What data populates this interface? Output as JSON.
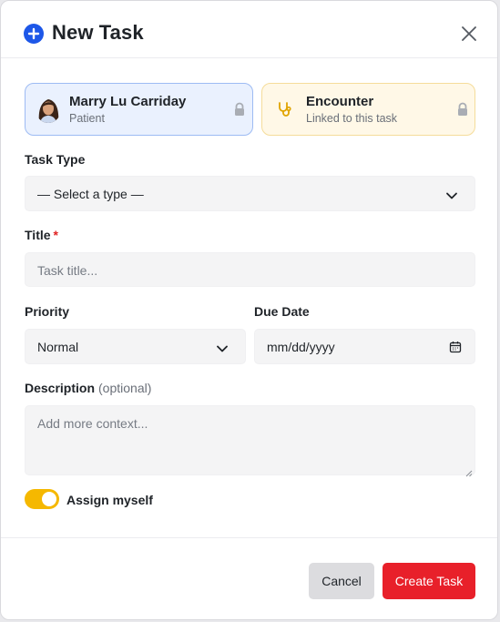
{
  "header": {
    "title": "New Task",
    "accent_color": "#1d57e8",
    "icons": {
      "leading": "plus-circle-icon",
      "close": "close-icon"
    }
  },
  "context": {
    "patient": {
      "name": "Marry Lu Carriday",
      "role": "Patient",
      "icon": "avatar",
      "locked": true
    },
    "encounter": {
      "title": "Encounter",
      "subtitle": "Linked to this task",
      "icon": "stethoscope-icon",
      "locked": true
    }
  },
  "form": {
    "task_type": {
      "label": "Task Type",
      "value": "— Select a type —"
    },
    "title": {
      "label": "Title",
      "required_mark": "*",
      "placeholder": "Task title..."
    },
    "priority": {
      "label": "Priority",
      "value": "Normal"
    },
    "due_date": {
      "label": "Due Date",
      "placeholder": "mm/dd/yyyy"
    },
    "description": {
      "label": "Description",
      "optional_note": "(optional)",
      "placeholder": "Add more context..."
    },
    "assign_myself": {
      "label": "Assign myself",
      "checked": true,
      "color": "#f5b800"
    }
  },
  "footer": {
    "cancel_label": "Cancel",
    "create_label": "Create Task",
    "create_color": "#e8202a"
  }
}
